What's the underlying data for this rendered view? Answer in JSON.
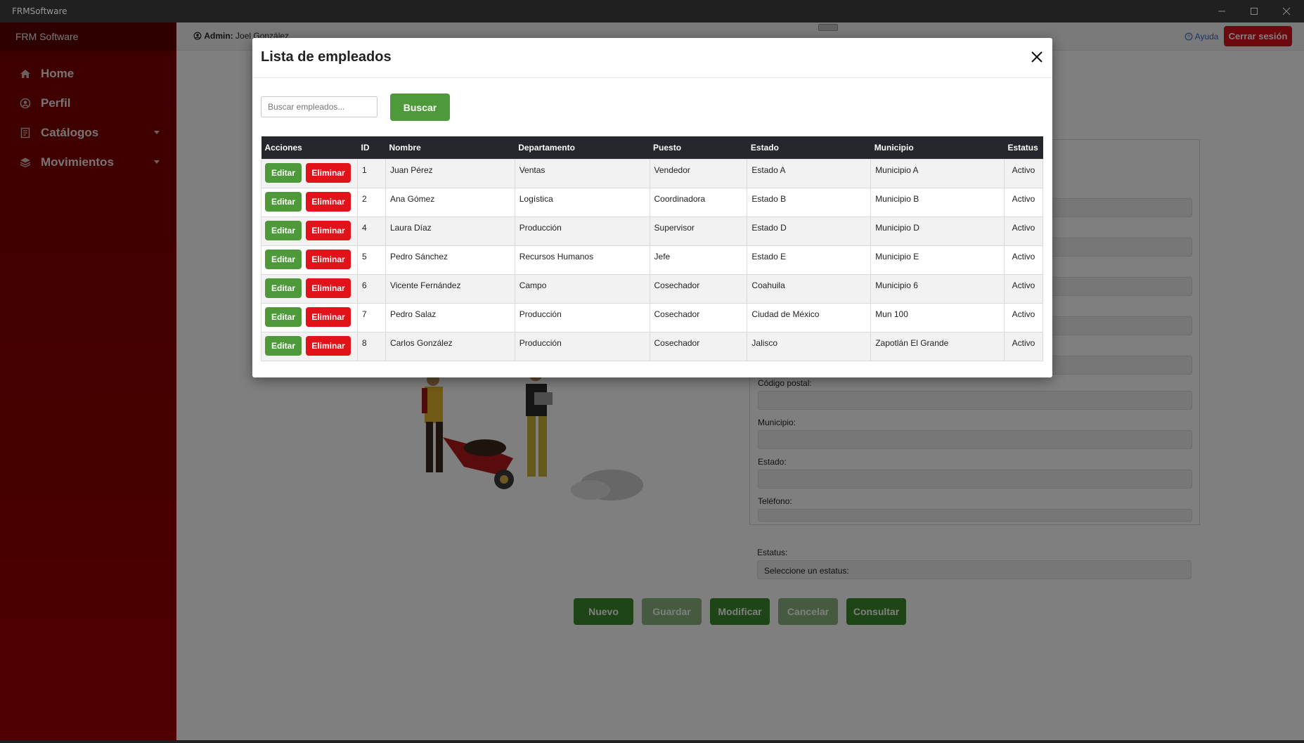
{
  "window": {
    "title": "FRMSoftware"
  },
  "sidebar": {
    "brand": "FRM Software",
    "items": [
      {
        "label": "Home",
        "icon": "home-icon"
      },
      {
        "label": "Perfil",
        "icon": "user-circle-icon"
      },
      {
        "label": "Catálogos",
        "icon": "catalog-icon"
      },
      {
        "label": "Movimientos",
        "icon": "layers-icon"
      }
    ]
  },
  "topbar": {
    "admin_prefix": "Admin:",
    "admin_name": "Joel González",
    "help": "Ayuda",
    "logout": "Cerrar sesión"
  },
  "form": {
    "labels": {
      "postal_code": "Código postal:",
      "municipality": "Municipio:",
      "state": "Estado:",
      "phone": "Teléfono:",
      "status": "Estatus:"
    },
    "status_placeholder": "Seleccione un estatus:"
  },
  "bottom_buttons": {
    "nuevo": "Nuevo",
    "guardar": "Guardar",
    "modificar": "Modificar",
    "cancelar": "Cancelar",
    "consultar": "Consultar"
  },
  "modal": {
    "title": "Lista de empleados",
    "search_placeholder": "Buscar empleados...",
    "search_button": "Buscar",
    "columns": [
      "Acciones",
      "ID",
      "Nombre",
      "Departamento",
      "Puesto",
      "Estado",
      "Municipio",
      "Estatus"
    ],
    "edit_label": "Editar",
    "delete_label": "Eliminar",
    "rows": [
      {
        "id": "1",
        "nombre": "Juan Pérez",
        "departamento": "Ventas",
        "puesto": "Vendedor",
        "estado": "Estado A",
        "municipio": "Municipio A",
        "estatus": "Activo"
      },
      {
        "id": "2",
        "nombre": "Ana Gómez",
        "departamento": "Logística",
        "puesto": "Coordinadora",
        "estado": "Estado B",
        "municipio": "Municipio B",
        "estatus": "Activo"
      },
      {
        "id": "4",
        "nombre": "Laura Díaz",
        "departamento": "Producción",
        "puesto": "Supervisor",
        "estado": "Estado D",
        "municipio": "Municipio D",
        "estatus": "Activo"
      },
      {
        "id": "5",
        "nombre": "Pedro Sánchez",
        "departamento": "Recursos Humanos",
        "puesto": "Jefe",
        "estado": "Estado E",
        "municipio": "Municipio E",
        "estatus": "Activo"
      },
      {
        "id": "6",
        "nombre": "Vicente Fernández",
        "departamento": "Campo",
        "puesto": "Cosechador",
        "estado": "Coahuila",
        "municipio": "Municipio 6",
        "estatus": "Activo"
      },
      {
        "id": "7",
        "nombre": "Pedro Salaz",
        "departamento": "Producción",
        "puesto": "Cosechador",
        "estado": "Ciudad de México",
        "municipio": "Mun 100",
        "estatus": "Activo"
      },
      {
        "id": "8",
        "nombre": "Carlos González",
        "departamento": "Producción",
        "puesto": "Cosechador",
        "estado": "Jalisco",
        "municipio": "Zapotlán El Grande",
        "estatus": "Activo"
      }
    ]
  },
  "colors": {
    "sidebar": "#8c0000",
    "primary_green": "#4e9a3a",
    "danger_red": "#e2121b",
    "table_header": "#24272b"
  }
}
